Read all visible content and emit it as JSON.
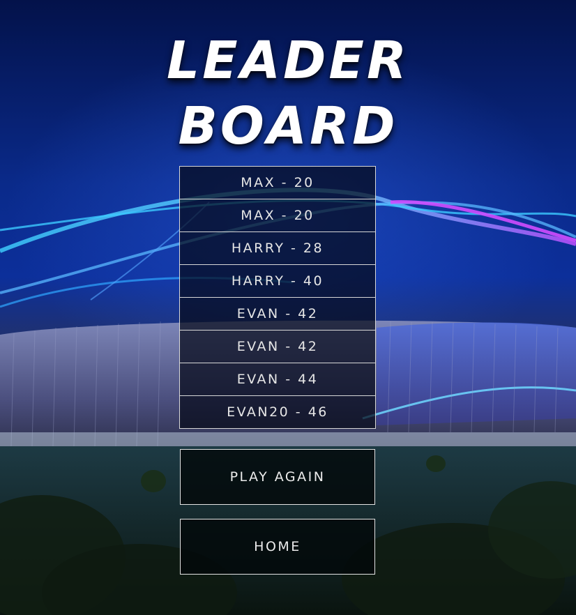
{
  "title": {
    "line1": "LEADER",
    "line2": "BOARD"
  },
  "leaderboard": {
    "entries": [
      "MAX - 20",
      "MAX - 20",
      "HARRY - 28",
      "HARRY - 40",
      "EVAN - 42",
      "EVAN - 42",
      "EVAN - 44",
      "EVAN20 - 46"
    ]
  },
  "buttons": {
    "play_again": "PLAY AGAIN",
    "home": "HOME"
  },
  "colors": {
    "background": "#0c2f9a",
    "text": "#e6e6e6",
    "border": "#d8d8d8"
  }
}
